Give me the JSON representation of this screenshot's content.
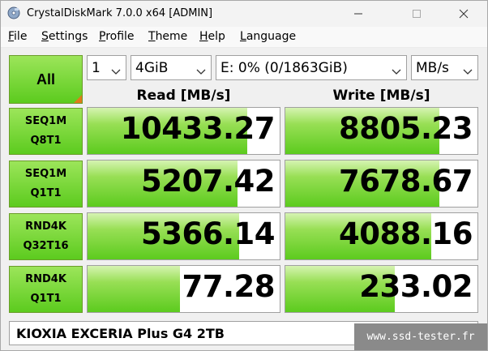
{
  "window": {
    "title": "CrystalDiskMark 7.0.0 x64 [ADMIN]"
  },
  "menu": {
    "items": [
      {
        "first": "F",
        "rest": "ile"
      },
      {
        "first": "S",
        "rest": "ettings"
      },
      {
        "first": "P",
        "rest": "rofile"
      },
      {
        "first": "T",
        "rest": "heme"
      },
      {
        "first": "H",
        "rest": "elp"
      },
      {
        "first": "L",
        "rest": "anguage"
      }
    ]
  },
  "controls": {
    "all_label": "All",
    "test_count": "1",
    "test_size": "4GiB",
    "drive": "E: 0% (0/1863GiB)",
    "unit": "MB/s"
  },
  "headers": {
    "read": "Read [MB/s]",
    "write": "Write [MB/s]"
  },
  "tests": [
    {
      "line1": "SEQ1M",
      "line2": "Q8T1",
      "read": "10433.27",
      "write": "8805.23",
      "read_fill": 0.83,
      "write_fill": 0.8
    },
    {
      "line1": "SEQ1M",
      "line2": "Q1T1",
      "read": "5207.42",
      "write": "7678.67",
      "read_fill": 0.78,
      "write_fill": 0.8
    },
    {
      "line1": "RND4K",
      "line2": "Q32T16",
      "read": "5366.14",
      "write": "4088.16",
      "read_fill": 0.79,
      "write_fill": 0.76
    },
    {
      "line1": "RND4K",
      "line2": "Q1T1",
      "read": "77.28",
      "write": "233.02",
      "read_fill": 0.48,
      "write_fill": 0.57
    }
  ],
  "comment": "KIOXIA EXCERIA Plus G4 2TB",
  "watermark": "www.ssd-tester.fr",
  "colors": {
    "bar_green": "#5ccb1e",
    "bar_light": "#d6f4b2",
    "corner_orange": "#e07a1a"
  }
}
